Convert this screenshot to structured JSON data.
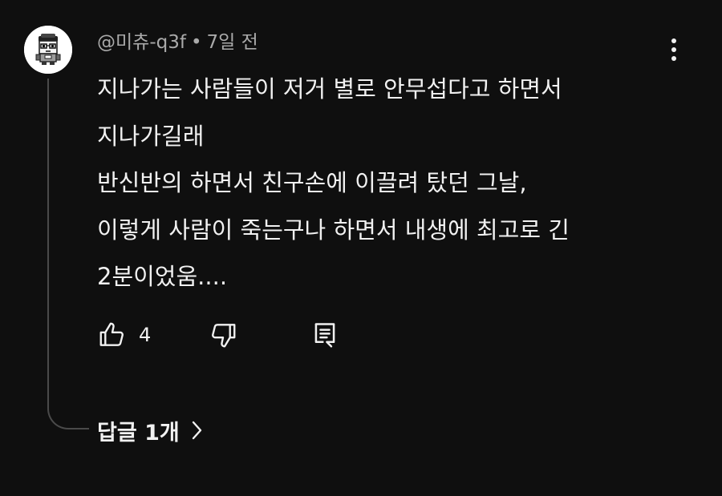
{
  "comment": {
    "author": "@미츄-q3f",
    "separator": "•",
    "time": "7일 전",
    "lines": [
      "지나가는 사람들이 저거 별로 안무섭다고 하면서",
      "지나가길래",
      "반신반의 하면서 친구손에 이끌려 탔던 그날,",
      "이렇게 사람이 죽는구나 하면서 내생에 최고로 긴",
      "2분이었움...."
    ],
    "like_count": "4",
    "replies_label": "답글 1개"
  },
  "icons": {
    "avatar": "cartoon-character-avatar",
    "more": "vertical-dots-icon",
    "like": "thumbs-up-icon",
    "dislike": "thumbs-down-icon",
    "reply": "reply-comment-icon",
    "expand": "chevron-right-icon"
  },
  "colors": {
    "background": "#0f0f0f",
    "primary_text": "#f1f1f1",
    "secondary_text": "#aaaaaa",
    "thread_line": "#4a4a4a"
  }
}
